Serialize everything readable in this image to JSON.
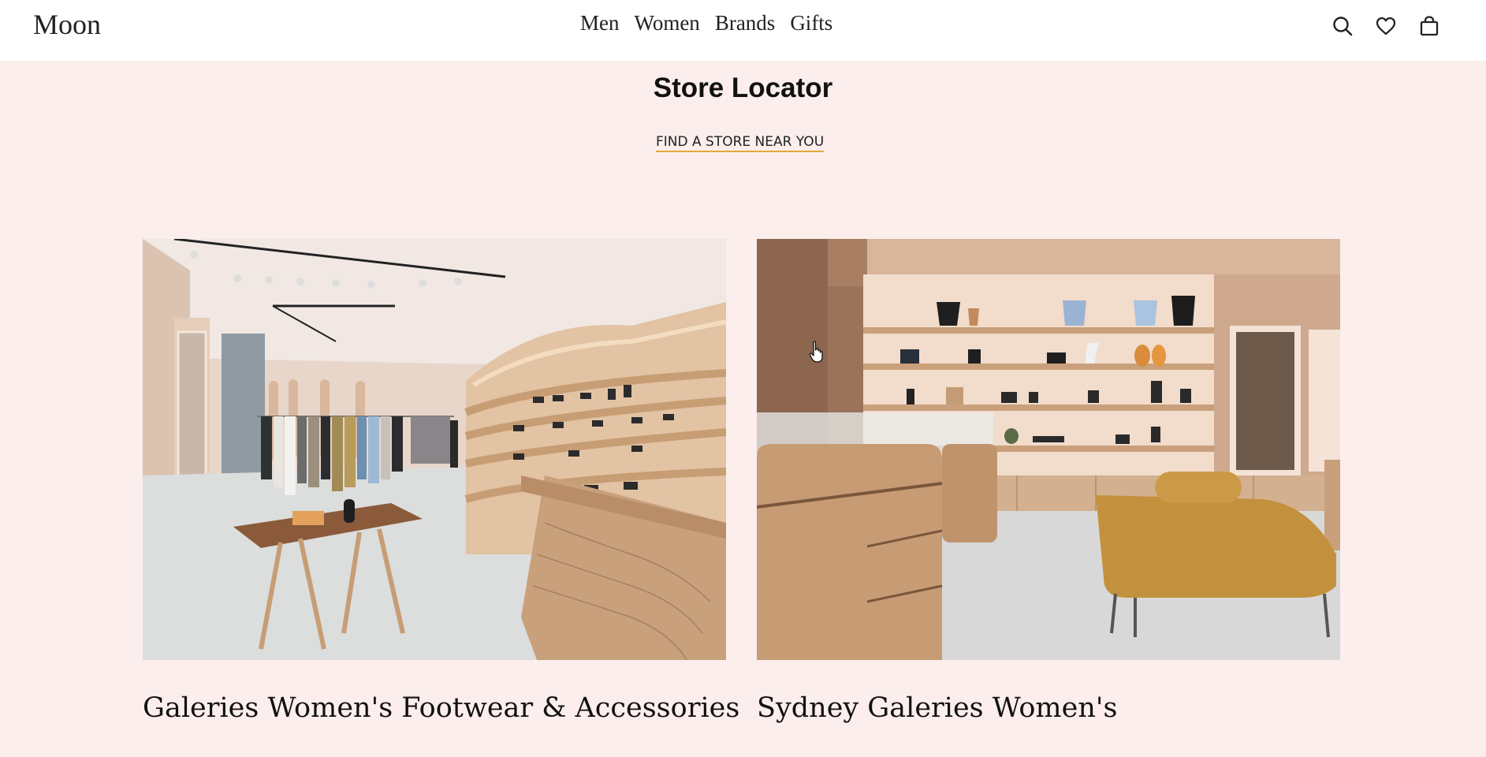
{
  "header": {
    "logo": "Moon",
    "nav": [
      "Men",
      "Women",
      "Brands",
      "Gifts"
    ],
    "icons": [
      "search-icon",
      "heart-icon",
      "bag-icon"
    ]
  },
  "main": {
    "title": "Store Locator",
    "find_link": "FIND A STORE NEAR YOU",
    "stores": [
      {
        "name": "Galeries Women's Footwear & Accessories"
      },
      {
        "name": "Sydney Galeries Women's"
      }
    ]
  },
  "colors": {
    "background": "#fbeeec",
    "header_bg": "#ffffff",
    "link_underline": "#e0a93a"
  }
}
